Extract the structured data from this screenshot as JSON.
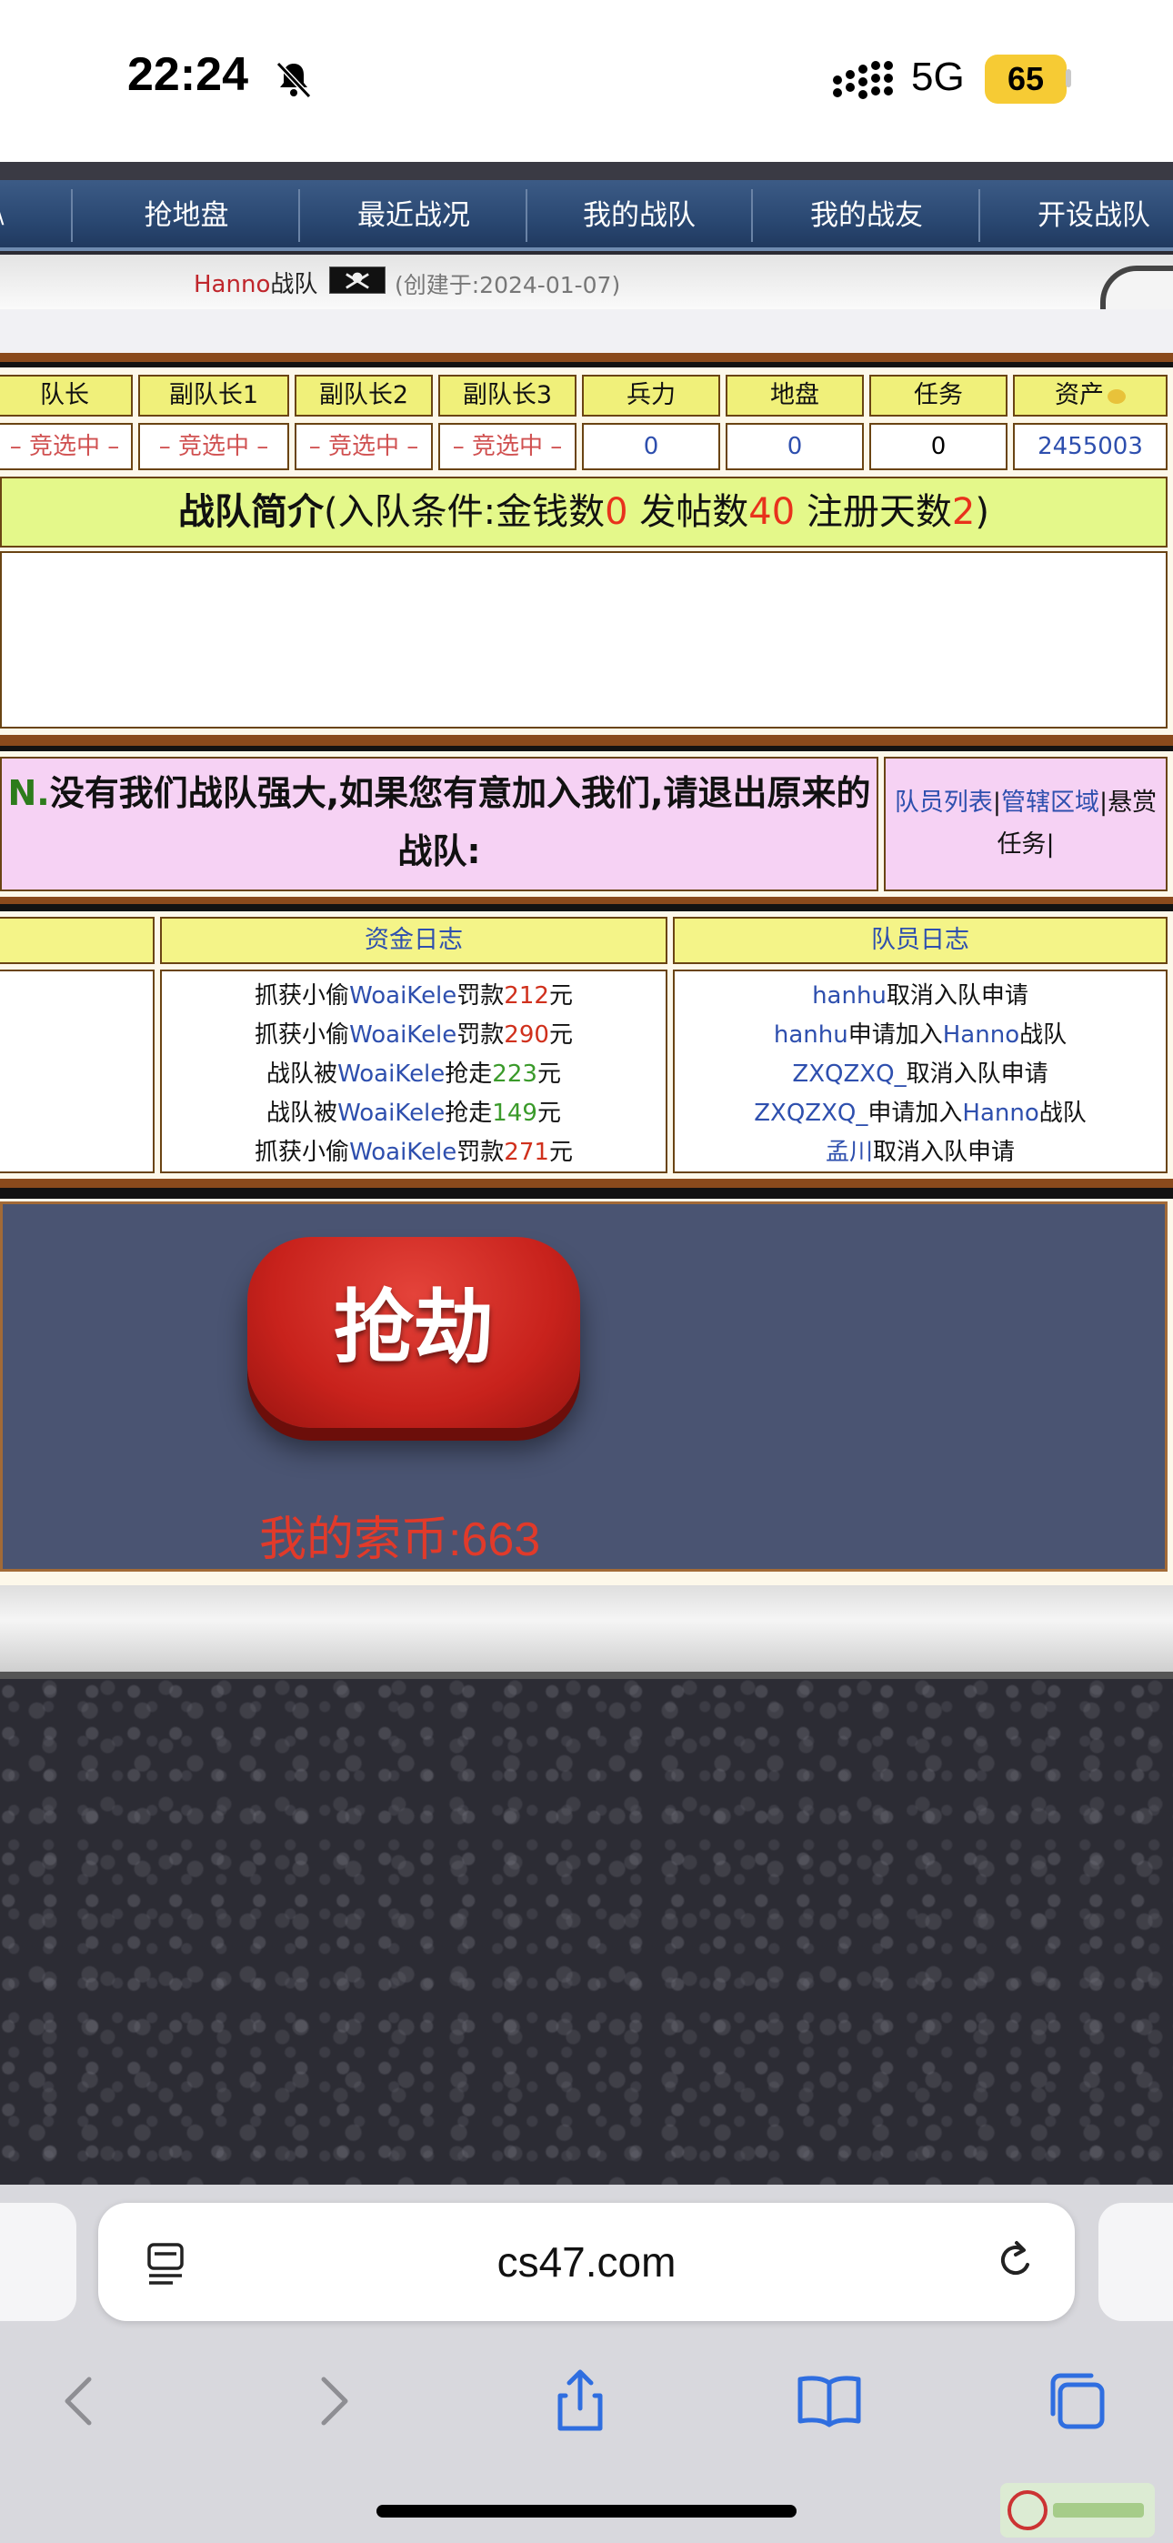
{
  "status_bar": {
    "time": "22:24",
    "network": "5G",
    "battery": "65"
  },
  "nav": {
    "left_partial": "\\",
    "items": [
      "抢地盘",
      "最近战况",
      "我的战队",
      "我的战友",
      "开设战队"
    ]
  },
  "team_header": {
    "name": "Hanno",
    "suffix": "战队",
    "created": "(创建于:2024-01-07)"
  },
  "stats": {
    "headers": [
      "队长",
      "副队长1",
      "副队长2",
      "副队长3",
      "兵力",
      "地盘",
      "任务",
      "资产"
    ],
    "values": [
      "– 竞选中 –",
      "– 竞选中 –",
      "– 竞选中 –",
      "– 竞选中 –",
      "0",
      "0",
      "0",
      "2455003"
    ]
  },
  "intro": {
    "title": "战队简介",
    "open": "(入队条件:金钱数",
    "money": "0",
    "posts_label": " 发帖数",
    "posts": "40",
    "days_label": " 注册天数",
    "days": "2",
    "close": ")"
  },
  "join_notice": {
    "prefix": "N.",
    "text": "没有我们战队强大,如果您有意加入我们,请退出原来的战队:"
  },
  "side_links": {
    "members": "队员列表",
    "sep1": "|",
    "area": "管辖区域",
    "sep2": "|",
    "bounty": "悬赏任务",
    "sep3": "|"
  },
  "fund_log": {
    "title": "资金日志",
    "entries": [
      {
        "a": "抓获小偷",
        "name": "WoaiKele",
        "b": "罚款",
        "amt": "212",
        "c": "元"
      },
      {
        "a": "抓获小偷",
        "name": "WoaiKele",
        "b": "罚款",
        "amt": "290",
        "c": "元"
      },
      {
        "a": "战队被",
        "name": "WoaiKele",
        "b": "抢走",
        "amt": "223",
        "c": "元"
      },
      {
        "a": "战队被",
        "name": "WoaiKele",
        "b": "抢走",
        "amt": "149",
        "c": "元"
      },
      {
        "a": "抓获小偷",
        "name": "WoaiKele",
        "b": "罚款",
        "amt": "271",
        "c": "元"
      }
    ]
  },
  "member_log": {
    "title": "队员日志",
    "entries": [
      {
        "name": "hanhu",
        "action": "取消入队申请",
        "team": "",
        "tail": ""
      },
      {
        "name": "hanhu",
        "action": "申请加入",
        "team": "Hanno",
        "tail": "战队"
      },
      {
        "name": "ZXQZXQ_",
        "action": "取消入队申请",
        "team": "",
        "tail": ""
      },
      {
        "name": "ZXQZXQ_",
        "action": "申请加入",
        "team": "Hanno",
        "tail": "战队"
      },
      {
        "name": "孟川",
        "action": "取消入队申请",
        "team": "",
        "tail": ""
      }
    ]
  },
  "rob": {
    "button": "抢劫",
    "coins": "我的索币:663"
  },
  "browser": {
    "url": "cs47.com"
  },
  "colors": {
    "nav": "#2a4872",
    "red_value": "#e8321c",
    "link_blue": "#2e4fae",
    "header_yellow": "#f0f07a",
    "pink": "#f6d2f4"
  }
}
